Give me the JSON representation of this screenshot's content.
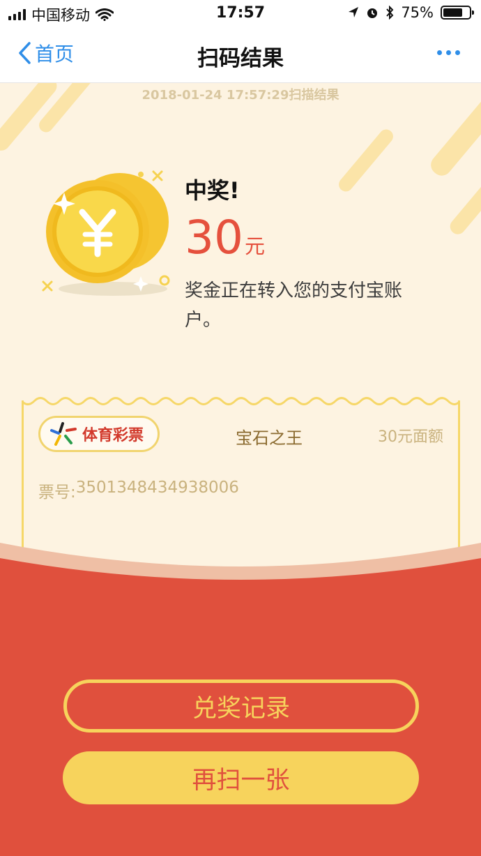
{
  "status_bar": {
    "carrier": "中国移动",
    "time": "17:57",
    "battery": "75%",
    "battery_level": 0.75,
    "icons": [
      "signal-icon",
      "wifi-icon",
      "location-icon",
      "alarm-icon",
      "bluetooth-icon",
      "battery-icon"
    ]
  },
  "nav": {
    "back_label": "首页",
    "title": "扫码结果",
    "more_icon": "more-icon"
  },
  "scan": {
    "timestamp": "2018-01-24 17:57:29扫描结果"
  },
  "prize": {
    "title": "中奖!",
    "amount": "30",
    "unit": "元",
    "description": "奖金正在转入您的支付宝账户。"
  },
  "ticket": {
    "logo_text": "体育彩票",
    "game_name": "宝石之王",
    "face_value": "30元面额",
    "number_label": "票号:",
    "number": "3501348434938006"
  },
  "buttons": {
    "records": "兑奖记录",
    "scan_again": "再扫一张"
  },
  "colors": {
    "accent_red": "#e0503d",
    "accent_yellow": "#f7d35c",
    "link_blue": "#2f8ee8",
    "cream_bg": "#fdf3e1"
  }
}
